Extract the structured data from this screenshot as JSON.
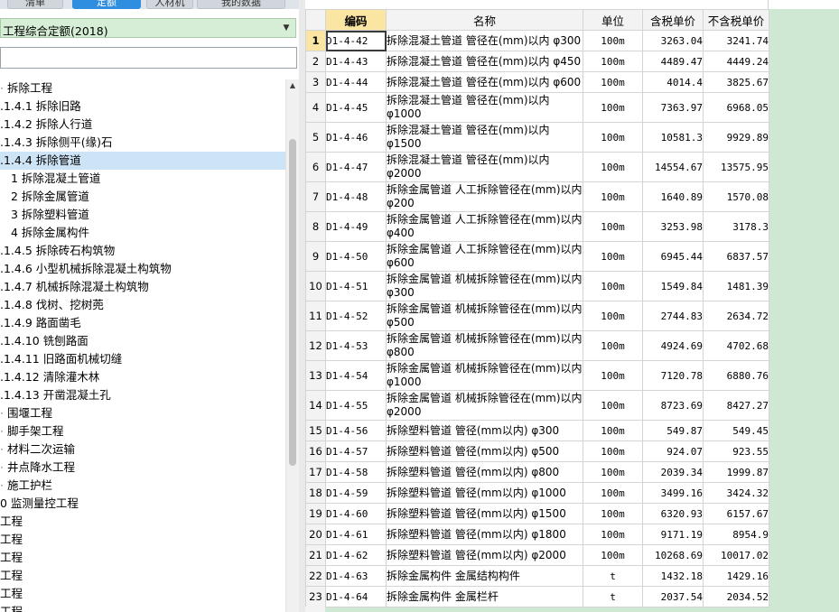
{
  "tabs": [
    {
      "label": "清单",
      "active": false
    },
    {
      "label": "定额",
      "active": true
    },
    {
      "label": "人材机",
      "active": false
    },
    {
      "label": "我的数据",
      "active": false
    }
  ],
  "library": {
    "selected": "工程综合定额(2018)",
    "search_placeholder": ""
  },
  "tree": [
    {
      "label": "拆除工程",
      "indent": 0,
      "prefix": "·",
      "selected": false
    },
    {
      "label": ".1.4.1 拆除旧路",
      "indent": 0,
      "selected": false
    },
    {
      "label": ".1.4.2 拆除人行道",
      "indent": 0,
      "selected": false
    },
    {
      "label": ".1.4.3 拆除侧平(缘)石",
      "indent": 0,
      "selected": false
    },
    {
      "label": ".1.4.4 拆除管道",
      "indent": 0,
      "selected": true
    },
    {
      "label": "1 拆除混凝土管道",
      "indent": 1,
      "selected": false
    },
    {
      "label": "2 拆除金属管道",
      "indent": 1,
      "selected": false
    },
    {
      "label": "3 拆除塑料管道",
      "indent": 1,
      "selected": false
    },
    {
      "label": "4 拆除金属构件",
      "indent": 1,
      "selected": false
    },
    {
      "label": ".1.4.5 拆除砖石构筑物",
      "indent": 0,
      "selected": false
    },
    {
      "label": ".1.4.6 小型机械拆除混凝土构筑物",
      "indent": 0,
      "selected": false
    },
    {
      "label": ".1.4.7 机械拆除混凝土构筑物",
      "indent": 0,
      "selected": false
    },
    {
      "label": ".1.4.8 伐树、挖树蔸",
      "indent": 0,
      "selected": false
    },
    {
      "label": ".1.4.9 路面凿毛",
      "indent": 0,
      "selected": false
    },
    {
      "label": ".1.4.10 铣刨路面",
      "indent": 0,
      "selected": false
    },
    {
      "label": ".1.4.11 旧路面机械切缝",
      "indent": 0,
      "selected": false
    },
    {
      "label": ".1.4.12 清除灌木林",
      "indent": 0,
      "selected": false
    },
    {
      "label": ".1.4.13 开凿混凝土孔",
      "indent": 0,
      "selected": false
    },
    {
      "label": "围堰工程",
      "indent": 0,
      "prefix": "·",
      "selected": false
    },
    {
      "label": "脚手架工程",
      "indent": 0,
      "prefix": "·",
      "selected": false
    },
    {
      "label": "材料二次运输",
      "indent": 0,
      "prefix": "·",
      "selected": false
    },
    {
      "label": "井点降水工程",
      "indent": 0,
      "prefix": "·",
      "selected": false
    },
    {
      "label": "施工护栏",
      "indent": 0,
      "prefix": "·",
      "selected": false
    },
    {
      "label": "0 监测量控工程",
      "indent": 0,
      "selected": false
    },
    {
      "label": "工程",
      "indent": -1,
      "selected": false
    },
    {
      "label": "工程",
      "indent": -1,
      "selected": false
    },
    {
      "label": "工程",
      "indent": -1,
      "selected": false
    },
    {
      "label": "工程",
      "indent": -1,
      "selected": false
    },
    {
      "label": "工程",
      "indent": -1,
      "selected": false
    },
    {
      "label": "工程",
      "indent": -1,
      "selected": false
    }
  ],
  "table": {
    "columns": [
      "编码",
      "名称",
      "单位",
      "含税单价",
      "不含税单价"
    ],
    "rows": [
      {
        "n": "1",
        "code": "D1-4-42",
        "name": "拆除混凝土管道 管径在(mm)以内 φ300",
        "unit": "100m",
        "price_tax": "3263.04",
        "price_notax": "3241.74",
        "tall": false
      },
      {
        "n": "2",
        "code": "D1-4-43",
        "name": "拆除混凝土管道 管径在(mm)以内 φ450",
        "unit": "100m",
        "price_tax": "4489.47",
        "price_notax": "4449.24",
        "tall": false
      },
      {
        "n": "3",
        "code": "D1-4-44",
        "name": "拆除混凝土管道 管径在(mm)以内 φ600",
        "unit": "100m",
        "price_tax": "4014.4",
        "price_notax": "3825.67",
        "tall": false
      },
      {
        "n": "4",
        "code": "D1-4-45",
        "name": "拆除混凝土管道 管径在(mm)以内\nφ1000",
        "unit": "100m",
        "price_tax": "7363.97",
        "price_notax": "6968.05",
        "tall": true
      },
      {
        "n": "5",
        "code": "D1-4-46",
        "name": "拆除混凝土管道 管径在(mm)以内\nφ1500",
        "unit": "100m",
        "price_tax": "10581.3",
        "price_notax": "9929.89",
        "tall": true
      },
      {
        "n": "6",
        "code": "D1-4-47",
        "name": "拆除混凝土管道 管径在(mm)以内\nφ2000",
        "unit": "100m",
        "price_tax": "14554.67",
        "price_notax": "13575.95",
        "tall": true
      },
      {
        "n": "7",
        "code": "D1-4-48",
        "name": "拆除金属管道 人工拆除管径在(mm)以内\nφ200",
        "unit": "100m",
        "price_tax": "1640.89",
        "price_notax": "1570.08",
        "tall": true
      },
      {
        "n": "8",
        "code": "D1-4-49",
        "name": "拆除金属管道 人工拆除管径在(mm)以内\nφ400",
        "unit": "100m",
        "price_tax": "3253.98",
        "price_notax": "3178.3",
        "tall": true
      },
      {
        "n": "9",
        "code": "D1-4-50",
        "name": "拆除金属管道 人工拆除管径在(mm)以内\nφ600",
        "unit": "100m",
        "price_tax": "6945.44",
        "price_notax": "6837.57",
        "tall": true
      },
      {
        "n": "10",
        "code": "D1-4-51",
        "name": "拆除金属管道 机械拆除管径在(mm)以内\nφ300",
        "unit": "100m",
        "price_tax": "1549.84",
        "price_notax": "1481.39",
        "tall": true
      },
      {
        "n": "11",
        "code": "D1-4-52",
        "name": "拆除金属管道 机械拆除管径在(mm)以内\nφ500",
        "unit": "100m",
        "price_tax": "2744.83",
        "price_notax": "2634.72",
        "tall": true
      },
      {
        "n": "12",
        "code": "D1-4-53",
        "name": "拆除金属管道 机械拆除管径在(mm)以内\nφ800",
        "unit": "100m",
        "price_tax": "4924.69",
        "price_notax": "4702.68",
        "tall": true
      },
      {
        "n": "13",
        "code": "D1-4-54",
        "name": "拆除金属管道 机械拆除管径在(mm)以内\nφ1000",
        "unit": "100m",
        "price_tax": "7120.78",
        "price_notax": "6880.76",
        "tall": true
      },
      {
        "n": "14",
        "code": "D1-4-55",
        "name": "拆除金属管道 机械拆除管径在(mm)以内\nφ2000",
        "unit": "100m",
        "price_tax": "8723.69",
        "price_notax": "8427.27",
        "tall": true
      },
      {
        "n": "15",
        "code": "D1-4-56",
        "name": "拆除塑料管道 管径(mm以内) φ300",
        "unit": "100m",
        "price_tax": "549.87",
        "price_notax": "549.45",
        "tall": false
      },
      {
        "n": "16",
        "code": "D1-4-57",
        "name": "拆除塑料管道 管径(mm以内) φ500",
        "unit": "100m",
        "price_tax": "924.07",
        "price_notax": "923.55",
        "tall": false
      },
      {
        "n": "17",
        "code": "D1-4-58",
        "name": "拆除塑料管道 管径(mm以内) φ800",
        "unit": "100m",
        "price_tax": "2039.34",
        "price_notax": "1999.87",
        "tall": false
      },
      {
        "n": "18",
        "code": "D1-4-59",
        "name": "拆除塑料管道 管径(mm以内) φ1000",
        "unit": "100m",
        "price_tax": "3499.16",
        "price_notax": "3424.32",
        "tall": false
      },
      {
        "n": "19",
        "code": "D1-4-60",
        "name": "拆除塑料管道 管径(mm以内) φ1500",
        "unit": "100m",
        "price_tax": "6320.93",
        "price_notax": "6157.67",
        "tall": false
      },
      {
        "n": "20",
        "code": "D1-4-61",
        "name": "拆除塑料管道 管径(mm以内) φ1800",
        "unit": "100m",
        "price_tax": "9171.19",
        "price_notax": "8954.9",
        "tall": false
      },
      {
        "n": "21",
        "code": "D1-4-62",
        "name": "拆除塑料管道 管径(mm以内) φ2000",
        "unit": "100m",
        "price_tax": "10268.69",
        "price_notax": "10017.02",
        "tall": false
      },
      {
        "n": "22",
        "code": "D1-4-63",
        "name": "拆除金属构件 金属结构构件",
        "unit": "t",
        "price_tax": "1432.18",
        "price_notax": "1429.16",
        "tall": false
      },
      {
        "n": "23",
        "code": "D1-4-64",
        "name": "拆除金属构件 金属栏杆",
        "unit": "t",
        "price_tax": "2037.54",
        "price_notax": "2034.52",
        "tall": false
      }
    ]
  },
  "colors": {
    "accent": "#2f8ee0",
    "selected_row": "#cde4f7",
    "header_highlight": "#fbe5a2",
    "dropdown_bg": "#d6eed6",
    "grid_bg": "#cfe8d3"
  }
}
